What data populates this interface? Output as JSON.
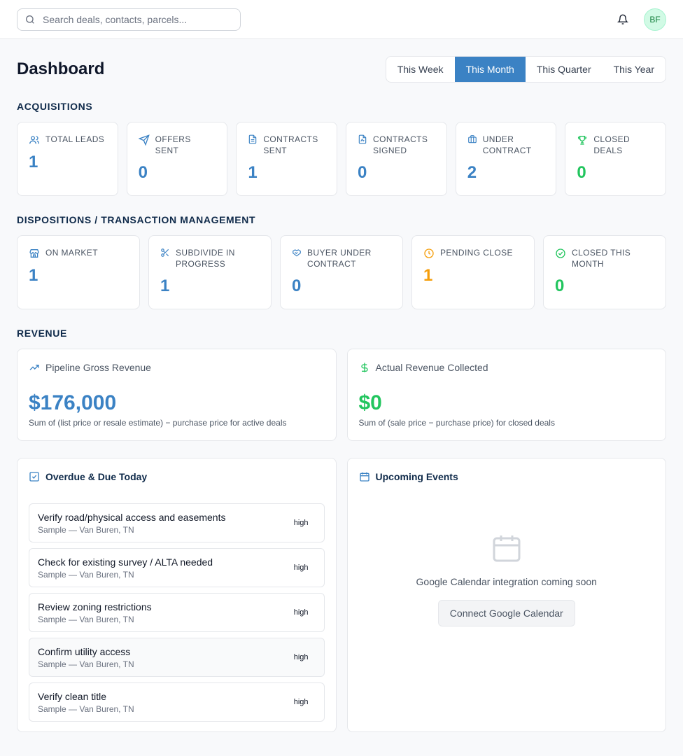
{
  "search": {
    "placeholder": "Search deals, contacts, parcels..."
  },
  "user": {
    "initials": "BF"
  },
  "header": {
    "title": "Dashboard",
    "periods": [
      "This Week",
      "This Month",
      "This Quarter",
      "This Year"
    ],
    "active_period": "This Month"
  },
  "acquisitions": {
    "title": "ACQUISITIONS",
    "cards": [
      {
        "label": "TOTAL LEADS",
        "value": "1",
        "icon": "users-icon"
      },
      {
        "label": "OFFERS SENT",
        "value": "0",
        "icon": "send-icon"
      },
      {
        "label": "CONTRACTS SENT",
        "value": "1",
        "icon": "document-icon"
      },
      {
        "label": "CONTRACTS SIGNED",
        "value": "0",
        "icon": "signed-document-icon"
      },
      {
        "label": "UNDER CONTRACT",
        "value": "2",
        "icon": "briefcase-icon"
      },
      {
        "label": "CLOSED DEALS",
        "value": "0",
        "icon": "trophy-icon"
      }
    ]
  },
  "dispositions": {
    "title": "DISPOSITIONS / TRANSACTION MANAGEMENT",
    "cards": [
      {
        "label": "ON MARKET",
        "value": "1",
        "icon": "store-icon"
      },
      {
        "label": "SUBDIVIDE IN PROGRESS",
        "value": "1",
        "icon": "scissors-icon"
      },
      {
        "label": "BUYER UNDER CONTRACT",
        "value": "0",
        "icon": "handshake-icon"
      },
      {
        "label": "PENDING CLOSE",
        "value": "1",
        "icon": "clock-icon"
      },
      {
        "label": "CLOSED THIS MONTH",
        "value": "0",
        "icon": "check-circle-icon"
      }
    ]
  },
  "revenue": {
    "title": "REVENUE",
    "pipeline": {
      "label": "Pipeline Gross Revenue",
      "value": "$176,000",
      "note": "Sum of (list price or resale estimate) − purchase price for active deals"
    },
    "actual": {
      "label": "Actual Revenue Collected",
      "value": "$0",
      "note": "Sum of (sale price − purchase price) for closed deals"
    }
  },
  "tasks": {
    "title": "Overdue & Due Today",
    "items": [
      {
        "title": "Verify road/physical access and easements",
        "sub": "Sample — Van Buren, TN",
        "priority": "high"
      },
      {
        "title": "Check for existing survey / ALTA needed",
        "sub": "Sample — Van Buren, TN",
        "priority": "high"
      },
      {
        "title": "Review zoning restrictions",
        "sub": "Sample — Van Buren, TN",
        "priority": "high"
      },
      {
        "title": "Confirm utility access",
        "sub": "Sample — Van Buren, TN",
        "priority": "high"
      },
      {
        "title": "Verify clean title",
        "sub": "Sample — Van Buren, TN",
        "priority": "high"
      }
    ]
  },
  "events": {
    "title": "Upcoming Events",
    "message": "Google Calendar integration coming soon",
    "button": "Connect Google Calendar"
  },
  "colors": {
    "accent": "#3b82c4",
    "success": "#22c55e",
    "warning": "#f59e0b"
  }
}
